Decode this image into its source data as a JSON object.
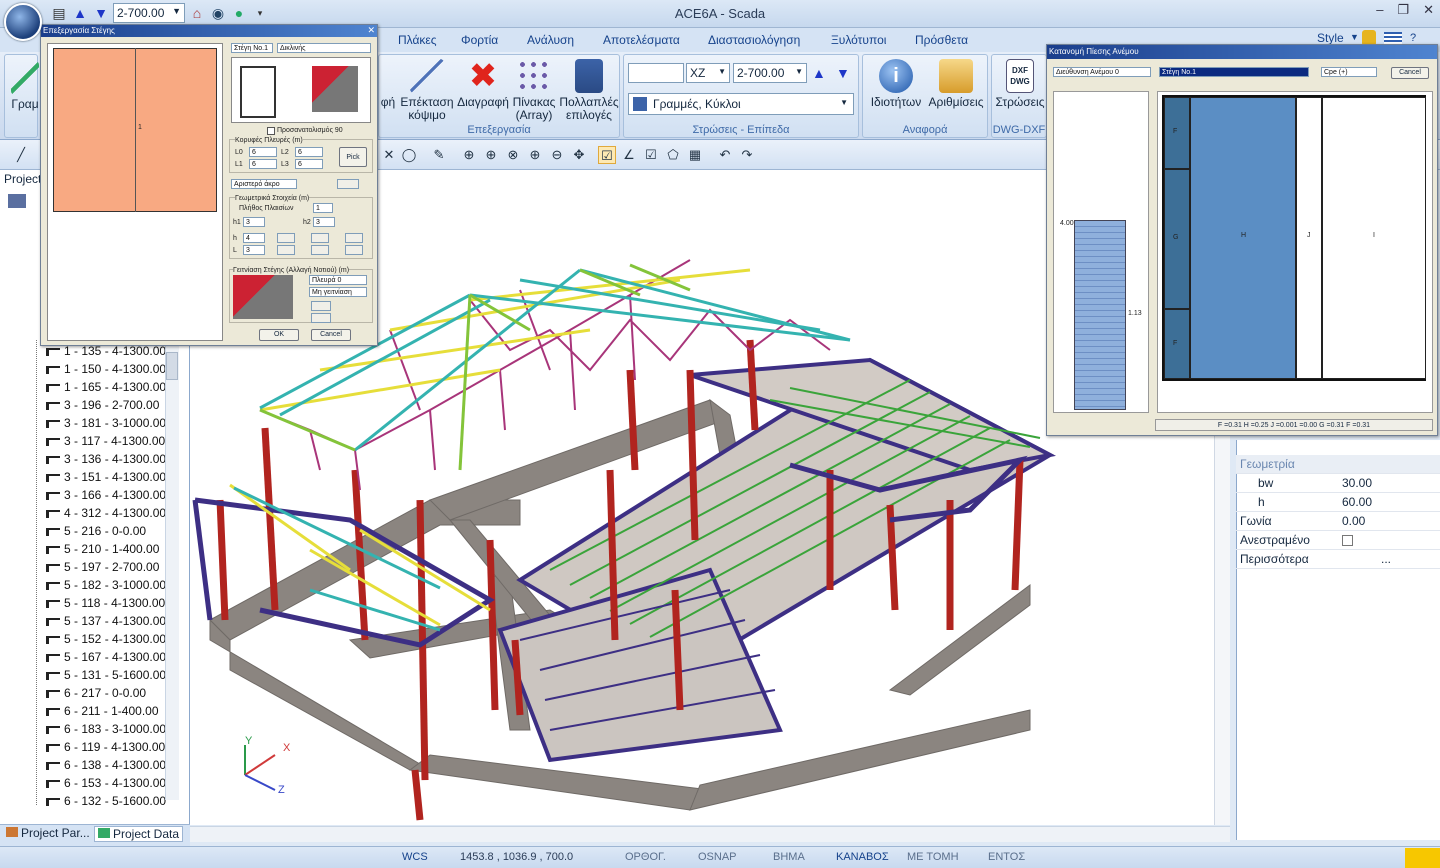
{
  "window": {
    "title": "ACE6A - Scada"
  },
  "quick_access": {
    "level_value": "2-700.00"
  },
  "menu": {
    "tabs": [
      "Πλάκες",
      "Φορτία",
      "Ανάλυση",
      "Αποτελέσματα",
      "Διαστασιολόγηση",
      "Ξυλότυποι",
      "Πρόσθετα"
    ],
    "style_label": "Style"
  },
  "ribbon": {
    "left_cut_label": "Γραμ",
    "left_cut_label2": "φή",
    "edit_group": {
      "label": "Επεξεργασία",
      "buttons": [
        {
          "label": "Επέκταση",
          "label2": "κόψιμο"
        },
        {
          "label": "Διαγραφή",
          "label2": ""
        },
        {
          "label": "Πίνακας",
          "label2": "(Array)"
        },
        {
          "label": "Πολλαπλές",
          "label2": "επιλογές"
        }
      ]
    },
    "layers_group": {
      "label": "Στρώσεις - Επίπεδα",
      "plane": "XZ",
      "level": "2-700.00",
      "layer": "Γραμμές, Κύκλοι"
    },
    "ref_group": {
      "label": "Αναφορά",
      "buttons": [
        "Ιδιοτήτων",
        "Αριθμίσεις"
      ]
    },
    "dwg_group": {
      "label": "DWG-DXF",
      "button": "Στρώσεις",
      "icon_text": "DXF DWG"
    }
  },
  "left_panel": {
    "header": "Project",
    "tree_items": [
      "1 - 135 - 4-1300.00",
      "1 - 150 - 4-1300.00",
      "1 - 165 - 4-1300.00",
      "3 - 196 - 2-700.00",
      "3 - 181 - 3-1000.00",
      "3 - 117 - 4-1300.00",
      "3 - 136 - 4-1300.00",
      "3 - 151 - 4-1300.00",
      "3 - 166 - 4-1300.00",
      "4 - 312 - 4-1300.00",
      "5 - 216 - 0-0.00",
      "5 - 210 - 1-400.00",
      "5 - 197 - 2-700.00",
      "5 - 182 - 3-1000.00",
      "5 - 118 - 4-1300.00",
      "5 - 137 - 4-1300.00",
      "5 - 152 - 4-1300.00",
      "5 - 167 - 4-1300.00",
      "5 - 131 - 5-1600.00",
      "6 - 217 - 0-0.00",
      "6 - 211 - 1-400.00",
      "6 - 183 - 3-1000.00",
      "6 - 119 - 4-1300.00",
      "6 - 138 - 4-1300.00",
      "6 - 153 - 4-1300.00",
      "6 - 132 - 5-1600.00"
    ],
    "bottom_tabs": [
      "Project Par...",
      "Project Data"
    ]
  },
  "roof_dialog": {
    "title": "Επεξεργασία Στέγης",
    "roof_select": "Στέγη Νο.1",
    "type_select": "Δικλινής",
    "cell_label": "1",
    "orientation": "Προσανατολισμός 90",
    "sides_label": "Κορυφές  Πλευρές (m)",
    "L0": "6",
    "L1": "6",
    "L2": "6",
    "L3": "6",
    "pick_btn": "Pick",
    "edge_select": "Αριστερό άκρο",
    "geo_label": "Γεωμετρικά Στοιχεία (m)",
    "panels_label": "Πλήθος Πλαισίων",
    "panels": "1",
    "h1": "3",
    "h2": "3",
    "h": "4",
    "L": "3",
    "neighbor_label": "Γειτνίαση Στέγης (Αλλαγή Νοτιού) (m)",
    "neighbor1": "Πλευρά 0",
    "neighbor2": "Μη γειτνίαση",
    "ok": "OK",
    "cancel": "Cancel"
  },
  "wind_dialog": {
    "title": "Κατανομή Πίεσης Ανέμου",
    "direction": "Διεύθυνση Ανέμου 0",
    "roof": "Στέγη Νο.1",
    "coef": "Cpe (+)",
    "cancel": "Cancel",
    "elev_top": "4.00",
    "elev_mid": "1.13",
    "zones": [
      "F",
      "G",
      "F",
      "H",
      "J",
      "I"
    ],
    "summary": "F =0.31 H =0.25 J =0.001 =0.00 G =0.31 F =0.31"
  },
  "properties": {
    "section": "Γεωμετρία",
    "rows": [
      {
        "key": "bw",
        "value": "30.00"
      },
      {
        "key": "h",
        "value": "60.00"
      },
      {
        "key": "Γωνία",
        "value": "0.00"
      },
      {
        "key": "Ανεστραμένο",
        "value": ""
      },
      {
        "key": "Περισσότερα",
        "value": "..."
      }
    ]
  },
  "axes": {
    "x": "X",
    "y": "Y",
    "z": "Z"
  },
  "status": {
    "wcs": "WCS",
    "coords": "1453.8 , 1036.9 , 700.0",
    "items": [
      "ΟΡΘΟΓ.",
      "OSNAP",
      "ΒΗΜΑ",
      "ΚΑΝΑΒΟΣ",
      "ΜΕ ΤΟΜΗ",
      "ΕΝΤΟΣ"
    ]
  }
}
